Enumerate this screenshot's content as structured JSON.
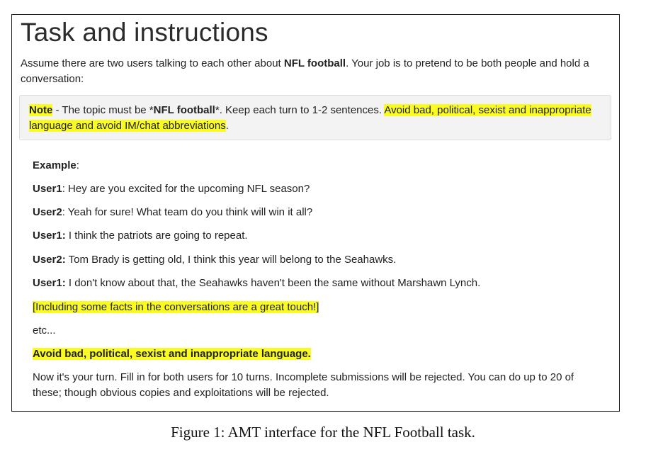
{
  "panel": {
    "title": "Task and instructions",
    "intro": {
      "prefix": "Assume there are two users talking to each other about ",
      "topic": "NFL football",
      "suffix": ". Your job is to pretend to be both people and hold a conversation:"
    },
    "note": {
      "label": "Note",
      "text1": " - The topic must be *",
      "topic": "NFL football",
      "text2": "*. Keep each turn to 1-2 sentences. ",
      "highlight": "Avoid bad, political, sexist and inappropriate language and avoid IM/chat abbreviations",
      "end": "."
    },
    "example": {
      "heading": "Example",
      "heading_suffix": ":",
      "turns": [
        {
          "speaker": "User1",
          "text": ": Hey are you excited for the upcoming NFL season?"
        },
        {
          "speaker": "User2",
          "text": ": Yeah for sure! What team do you think will win it all?"
        },
        {
          "speaker": "User1:",
          "text": " I think the patriots are going to repeat."
        },
        {
          "speaker": "User2:",
          "text": " Tom Brady is getting old, I think this year will belong to the Seahawks."
        },
        {
          "speaker": "User1:",
          "text": " I don't know about that, the Seahawks haven't been the same without Marshawn Lynch."
        }
      ],
      "facts_note": "[Including some facts in the conversations are a great touch!]",
      "etc": "etc...",
      "warning": "Avoid bad, political, sexist and inappropriate language.",
      "closing": "Now it's your turn. Fill in for both users for 10 turns. Incomplete submissions will be rejected. You can do up to 20 of these; though obvious copies and exploitations will be rejected."
    }
  },
  "caption": "Figure 1: AMT interface for the NFL Football task.",
  "colors": {
    "highlight": "#fbfb24",
    "note_background": "#f3f3f3",
    "border": "#1a1a1a"
  }
}
